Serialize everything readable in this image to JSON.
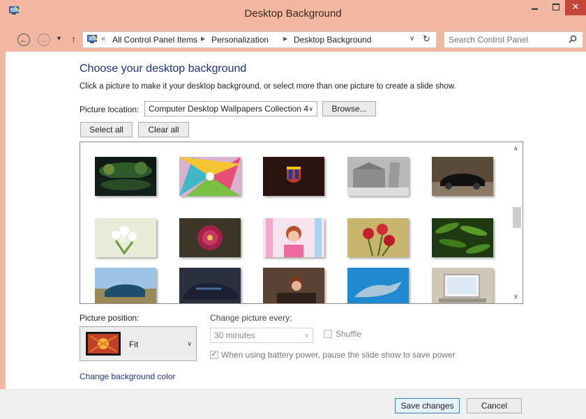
{
  "window": {
    "title": "Desktop Background"
  },
  "nav": {
    "breadcrumb": [
      "All Control Panel Items",
      "Personalization",
      "Desktop Background"
    ],
    "chevrons": "«",
    "search_placeholder": "Search Control Panel"
  },
  "content": {
    "heading": "Choose your desktop background",
    "instruction": "Click a picture to make it your desktop background, or select more than one picture to create a slide show.",
    "location_label": "Picture location:",
    "location_value": "Computer Desktop Wallpapers Collection 4",
    "browse_label": "Browse...",
    "select_all_label": "Select all",
    "clear_all_label": "Clear all"
  },
  "gallery": {
    "thumbnails": [
      {
        "subject": "night-reflection-lake"
      },
      {
        "subject": "colorful-swirl"
      },
      {
        "subject": "fc-barcelona-crest"
      },
      {
        "subject": "leaning-tower-pisa"
      },
      {
        "subject": "black-sports-car"
      },
      {
        "subject": "white-flowers-vase"
      },
      {
        "subject": "red-dahlia"
      },
      {
        "subject": "woman-portrait"
      },
      {
        "subject": "red-roses"
      },
      {
        "subject": "cucumbers"
      },
      {
        "subject": "blue-car-field"
      },
      {
        "subject": "racing-car"
      },
      {
        "subject": "woman-lying"
      },
      {
        "subject": "dolphin"
      },
      {
        "subject": "laptop-desk"
      }
    ],
    "scroll_position": 0.4
  },
  "options": {
    "position_label": "Picture position:",
    "position_value": "Fit",
    "change_label": "Change picture every:",
    "interval_value": "30 minutes",
    "shuffle_label": "Shuffle",
    "shuffle_checked": false,
    "battery_label": "When using battery power, pause the slide show to save power",
    "battery_checked": true,
    "bg_color_link": "Change background color"
  },
  "footer": {
    "save_label": "Save changes",
    "cancel_label": "Cancel"
  },
  "colors": {
    "titlebar": "#f2b7a1",
    "heading": "#1e3287",
    "close": "#c8453a"
  }
}
